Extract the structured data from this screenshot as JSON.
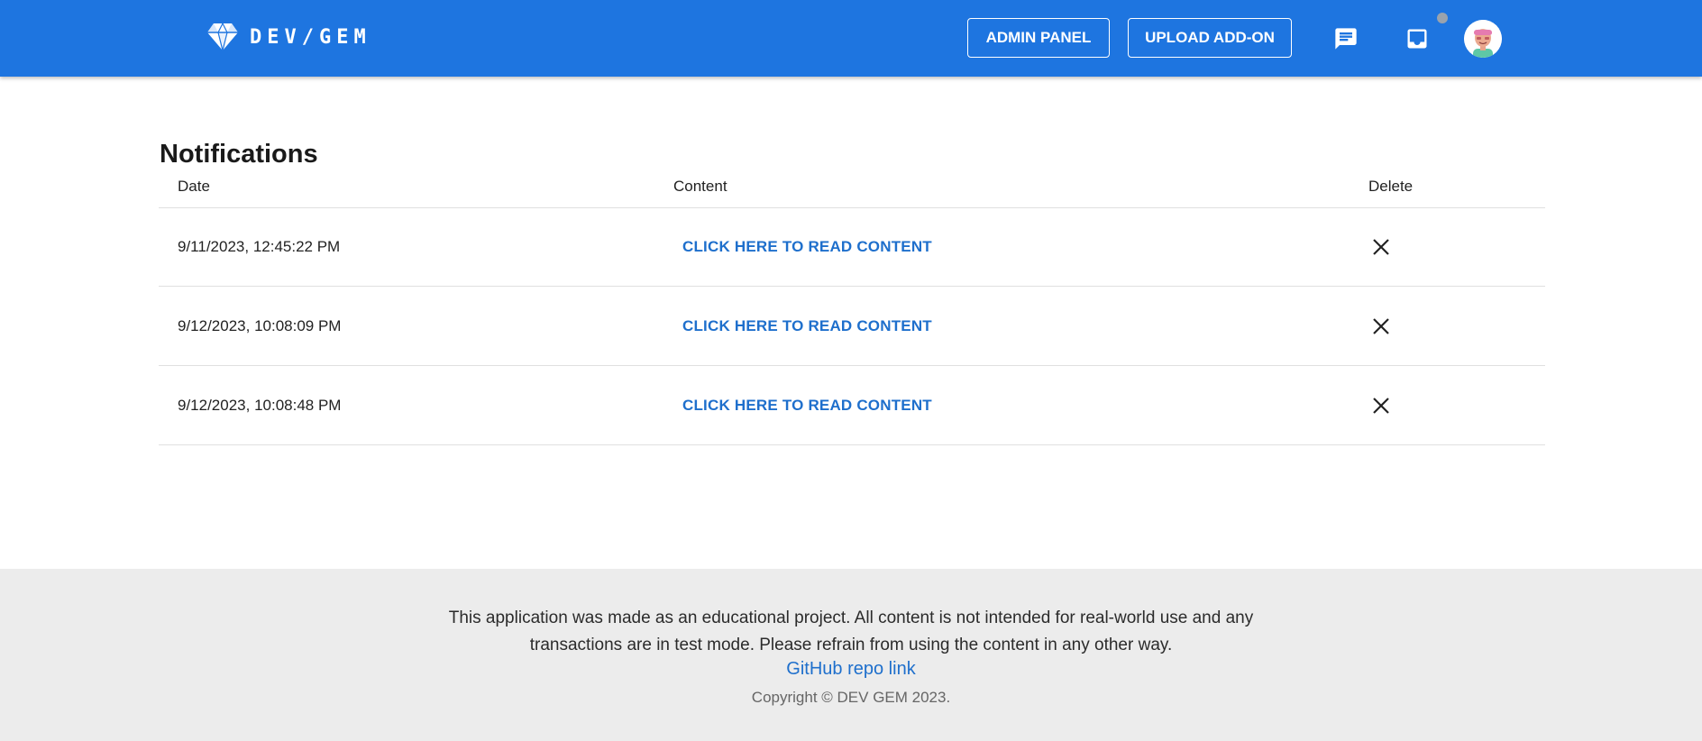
{
  "header": {
    "logo_text": "DEV/GEM",
    "admin_label": "ADMIN PANEL",
    "upload_label": "UPLOAD ADD-ON",
    "accent_color": "#1e75e0"
  },
  "page": {
    "title": "Notifications"
  },
  "table": {
    "columns": [
      "Date",
      "Content",
      "Delete"
    ],
    "rows": [
      {
        "date": "9/11/2023, 12:45:22 PM",
        "content": "CLICK HERE TO READ CONTENT"
      },
      {
        "date": "9/12/2023, 10:08:09 PM",
        "content": "CLICK HERE TO READ CONTENT"
      },
      {
        "date": "9/12/2023, 10:08:48 PM",
        "content": "CLICK HERE TO READ CONTENT"
      }
    ]
  },
  "footer": {
    "disclaimer": "This application was made as an educational project. All content is not intended for real-world use and any transactions are in test mode. Please refrain from using the content in any other way.",
    "link_label": "GitHub repo link",
    "copyright": "Copyright © DEV GEM  2023."
  },
  "icons": {
    "logo": "diamond-icon",
    "chat": "chat-icon",
    "inbox": "inbox-icon",
    "avatar": "user-avatar",
    "delete": "close-icon"
  }
}
